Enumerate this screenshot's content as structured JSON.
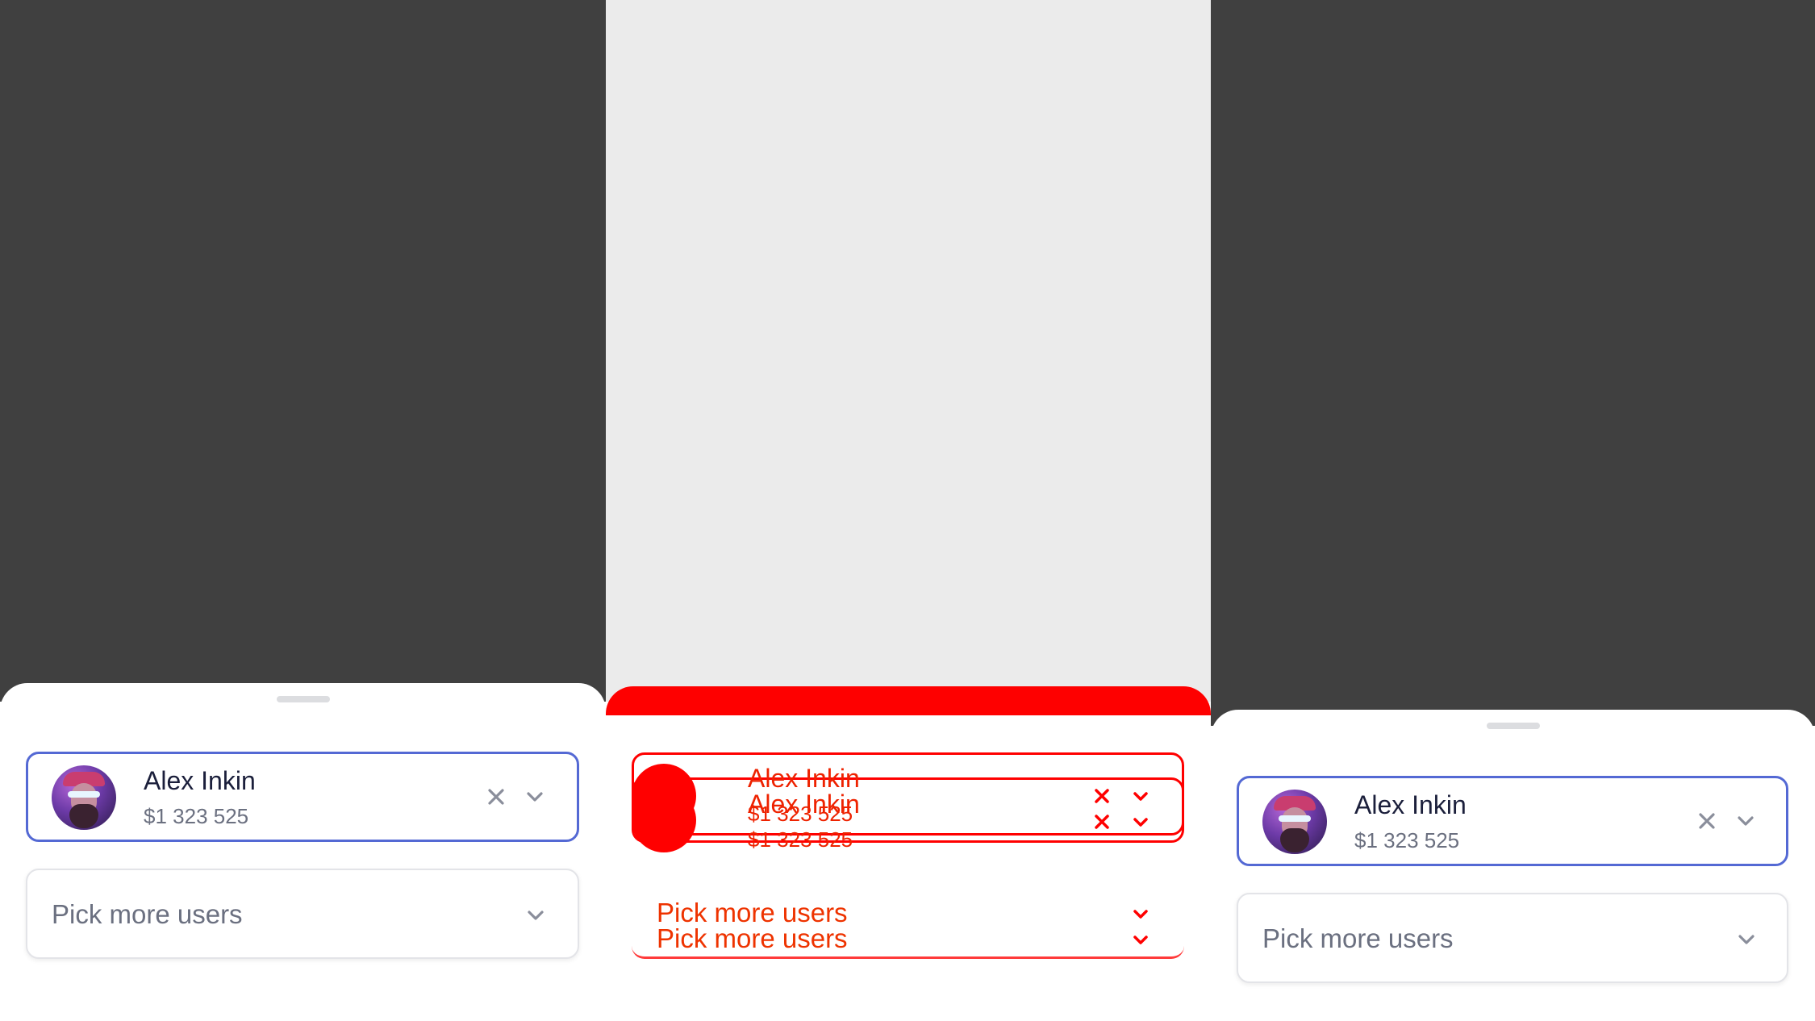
{
  "selected_user": {
    "name": "Alex Inkin",
    "amount": "$1 323 525",
    "avatar": "user-avatar"
  },
  "picker": {
    "placeholder": "Pick more users"
  },
  "icons": {
    "clear": "close-icon",
    "expand": "chevron-down-icon"
  },
  "colors": {
    "backdrop_dark": "#404040",
    "backdrop_light": "#ebebeb",
    "accent": "#5469d4",
    "debug_overlay": "#ff0000"
  }
}
